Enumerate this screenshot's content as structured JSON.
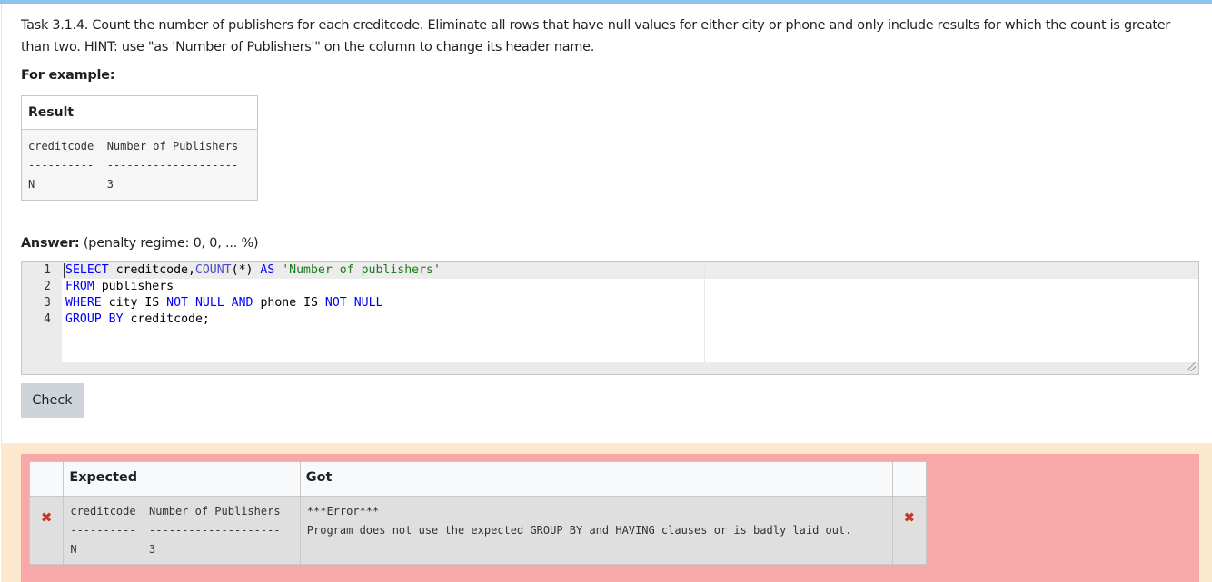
{
  "task": {
    "text": "Task 3.1.4. Count the number of publishers for each creditcode. Eliminate all rows that have null values for either city or phone and only include results for which the count is greater than two. HINT: use \"as 'Number of Publishers'\" on the column to change its header name."
  },
  "example": {
    "heading": "For example:",
    "table_header": "Result",
    "output": "creditcode  Number of Publishers\n----------  --------------------\nN           3"
  },
  "answer": {
    "label": "Answer:",
    "penalty": "(penalty regime: 0, 0, ... %)",
    "line_numbers": [
      "1",
      "2",
      "3",
      "4"
    ],
    "code_lines": [
      [
        {
          "t": "SELECT",
          "c": "kw"
        },
        {
          "t": " creditcode,",
          "c": ""
        },
        {
          "t": "COUNT",
          "c": "fn"
        },
        {
          "t": "(*) ",
          "c": ""
        },
        {
          "t": "AS",
          "c": "kw"
        },
        {
          "t": " ",
          "c": ""
        },
        {
          "t": "'Number of publishers'",
          "c": "str"
        }
      ],
      [
        {
          "t": "FROM",
          "c": "kw"
        },
        {
          "t": " publishers",
          "c": ""
        }
      ],
      [
        {
          "t": "WHERE",
          "c": "kw"
        },
        {
          "t": " city IS ",
          "c": ""
        },
        {
          "t": "NOT",
          "c": "kw"
        },
        {
          "t": " ",
          "c": ""
        },
        {
          "t": "NULL",
          "c": "kw"
        },
        {
          "t": " ",
          "c": ""
        },
        {
          "t": "AND",
          "c": "kw"
        },
        {
          "t": " phone IS ",
          "c": ""
        },
        {
          "t": "NOT",
          "c": "kw"
        },
        {
          "t": " ",
          "c": ""
        },
        {
          "t": "NULL",
          "c": "kw"
        }
      ],
      [
        {
          "t": "GROUP",
          "c": "kw"
        },
        {
          "t": " ",
          "c": ""
        },
        {
          "t": "BY",
          "c": "kw"
        },
        {
          "t": " creditcode;",
          "c": ""
        }
      ]
    ]
  },
  "check_button": "Check",
  "results": {
    "headers": [
      "",
      "Expected",
      "Got",
      ""
    ],
    "row": {
      "mark_left": "✖",
      "expected": "creditcode  Number of Publishers\n----------  --------------------\nN           3",
      "got": "***Error***\nProgram does not use the expected GROUP BY and HAVING clauses or is badly laid out.",
      "mark_right": "✖"
    }
  }
}
